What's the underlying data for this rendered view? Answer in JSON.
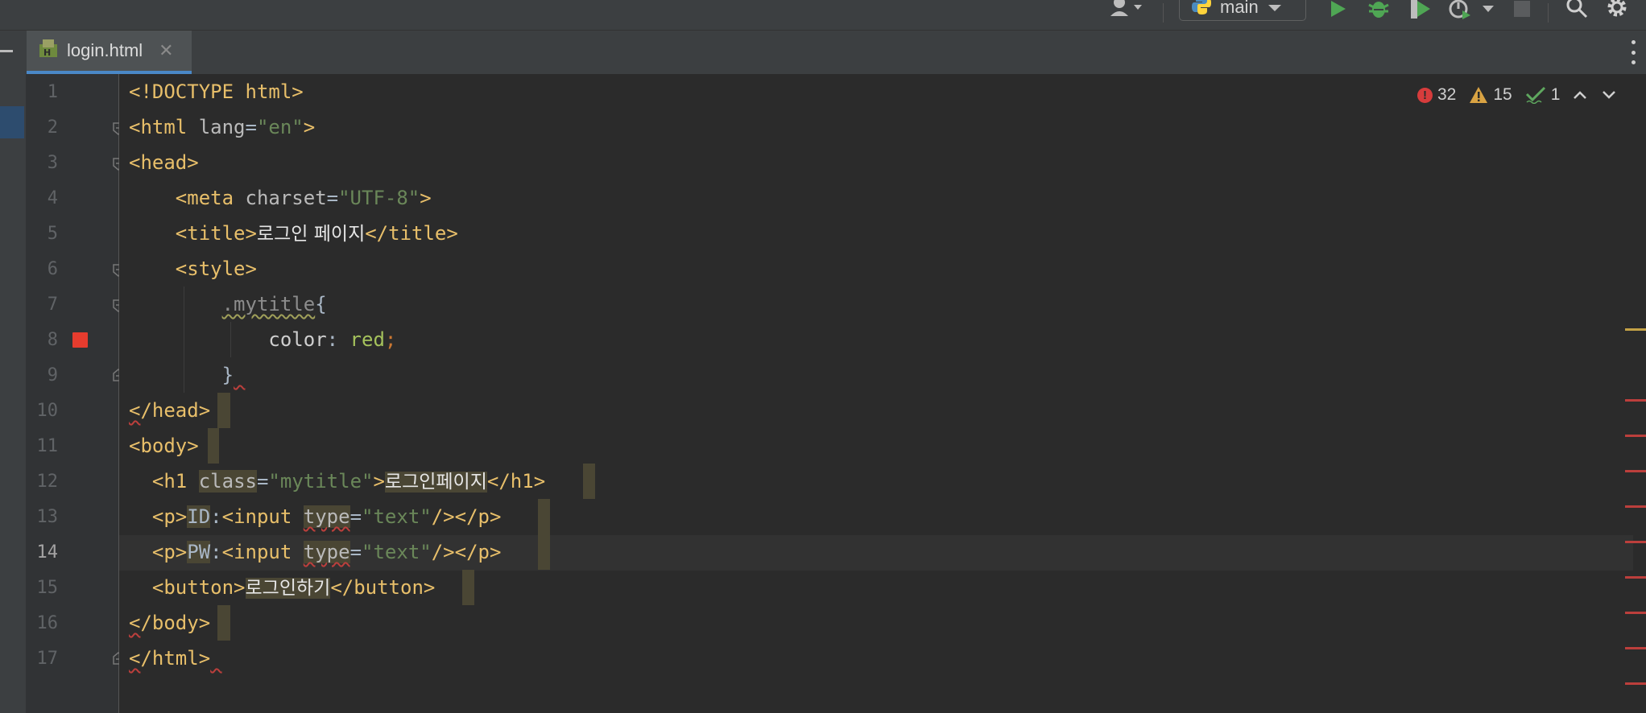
{
  "toolbar": {
    "branch_label": "main",
    "icons": [
      "user-icon",
      "python-icon",
      "run-icon",
      "debug-icon",
      "coverage-icon",
      "profile-icon",
      "stop-icon",
      "search-icon",
      "settings-icon"
    ]
  },
  "tab": {
    "filename": "login.html",
    "close": "✕"
  },
  "line_numbers": [
    "1",
    "2",
    "3",
    "4",
    "5",
    "6",
    "7",
    "8",
    "9",
    "10",
    "11",
    "12",
    "13",
    "14",
    "15",
    "16",
    "17"
  ],
  "current_line": "14",
  "inspections": {
    "errors": "32",
    "warnings": "15",
    "ok": "1"
  },
  "code": {
    "l1": {
      "doctype": "<!DOCTYPE html>"
    },
    "l2": {
      "open": "<html",
      "attr": "lang",
      "eq": "=",
      "val": "\"en\"",
      "close": ">"
    },
    "l3": {
      "tag": "<head>"
    },
    "l4": {
      "open": "<meta",
      "attr": "charset",
      "eq": "=",
      "val": "\"UTF-8\"",
      "close": ">"
    },
    "l5": {
      "open": "<title>",
      "text": "로그인 페이지",
      "close": "</title>"
    },
    "l6": {
      "tag": "<style>"
    },
    "l7": {
      "selector": ".mytitle",
      "brace": "{"
    },
    "l8": {
      "prop": "color",
      "colon": ": ",
      "value": "red",
      "semi": ";"
    },
    "l9": {
      "brace": "}"
    },
    "l10": {
      "lt": "<",
      "rest": "/head>"
    },
    "l11": {
      "tag": "<body>"
    },
    "l12": {
      "open": "<h1",
      "attr": "class",
      "eq": "=",
      "val": "\"mytitle\"",
      "gt": ">",
      "text": "로그인페이지",
      "close": "</h1>"
    },
    "l13": {
      "open": "<p>",
      "label": "ID",
      "colon": ":",
      "input_open": "<input",
      "attr": "type",
      "eq": "=",
      "val": "\"text\"",
      "selfclose": "/>",
      "close": "</p>"
    },
    "l14": {
      "open": "<p>",
      "label": "PW",
      "colon": ":",
      "input_open": "<input",
      "attr": "type",
      "eq": "=",
      "val": "\"text\"",
      "selfclose": "/>",
      "close": "</p>"
    },
    "l15": {
      "open": "<button>",
      "text": "로그인하기",
      "close": "</button>"
    },
    "l16": {
      "lt": "<",
      "rest": "/body>"
    },
    "l17": {
      "lt": "<",
      "rest": "/html>"
    }
  }
}
